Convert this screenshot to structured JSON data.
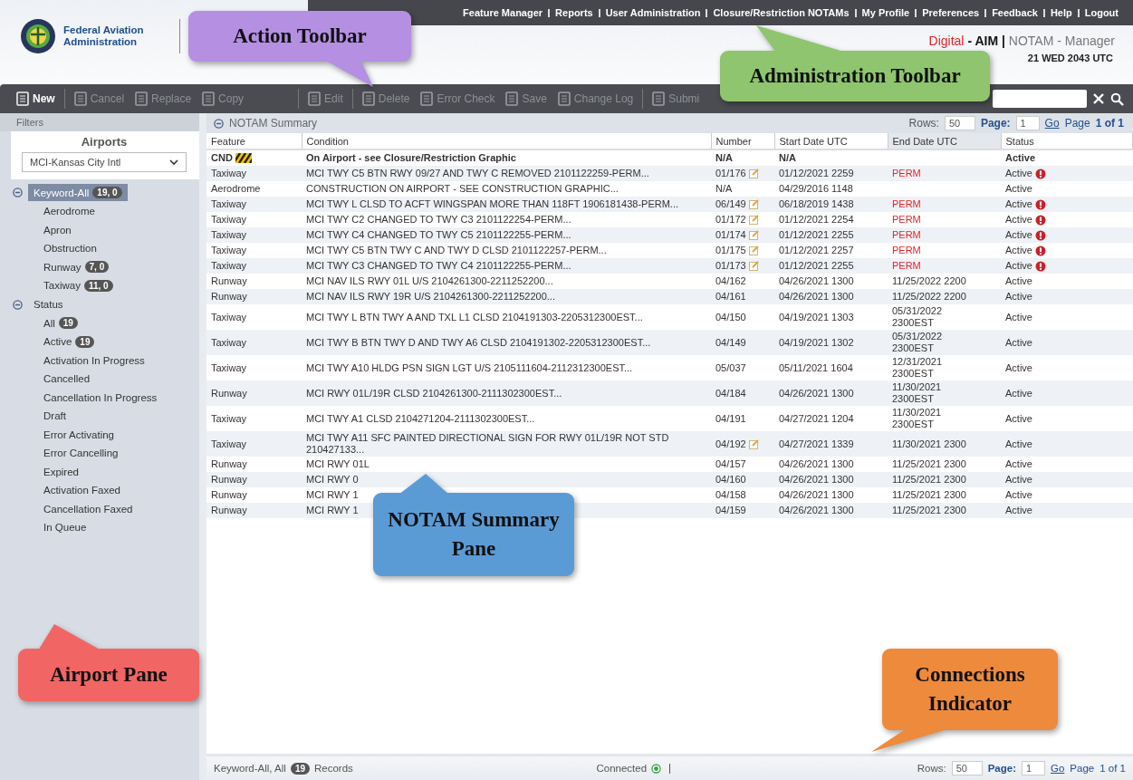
{
  "header": {
    "agency": "Federal Aviation Administration",
    "admin_links": [
      "Feature Manager",
      "Reports",
      "User Administration",
      "Closure/Restriction NOTAMs",
      "My Profile",
      "Preferences",
      "Feedback",
      "Help",
      "Logout"
    ],
    "brand": {
      "digital": "Digital",
      "aim": "- AIM |",
      "product": "NOTAM - Manager"
    },
    "datetime": "21 WED 2043 UTC"
  },
  "toolbar": [
    {
      "kind": "button",
      "label": "New",
      "disabled": false
    },
    {
      "kind": "separator"
    },
    {
      "kind": "button",
      "label": "Cancel",
      "disabled": true
    },
    {
      "kind": "button",
      "label": "Replace",
      "disabled": true
    },
    {
      "kind": "button",
      "label": "Copy",
      "disabled": true
    },
    {
      "kind": "gap"
    },
    {
      "kind": "separator"
    },
    {
      "kind": "button",
      "label": "Edit",
      "disabled": true
    },
    {
      "kind": "separator"
    },
    {
      "kind": "button",
      "label": "Delete",
      "disabled": true
    },
    {
      "kind": "button",
      "label": "Error Check",
      "disabled": true
    },
    {
      "kind": "button",
      "label": "Save",
      "disabled": true
    },
    {
      "kind": "button",
      "label": "Change Log",
      "disabled": true
    },
    {
      "kind": "separator"
    },
    {
      "kind": "button",
      "label": "Submi",
      "disabled": true
    }
  ],
  "filters": {
    "title": "Filters",
    "airports_label": "Airports",
    "airport": "MCI-Kansas City Intl",
    "groups": [
      {
        "label": "Keyword-All",
        "badge": "19, 0",
        "selected": true,
        "expanded": true,
        "children": [
          {
            "label": "Aerodrome"
          },
          {
            "label": "Apron"
          },
          {
            "label": "Obstruction"
          },
          {
            "label": "Runway",
            "badge": "7, 0"
          },
          {
            "label": "Taxiway",
            "badge": "11, 0"
          }
        ]
      },
      {
        "label": "Status",
        "selected": false,
        "expanded": true,
        "children": [
          {
            "label": "All",
            "badge": "19"
          },
          {
            "label": "Active",
            "badge": "19"
          },
          {
            "label": "Activation In Progress"
          },
          {
            "label": "Cancelled"
          },
          {
            "label": "Cancellation In Progress"
          },
          {
            "label": "Draft"
          },
          {
            "label": "Error Activating"
          },
          {
            "label": "Error Cancelling"
          },
          {
            "label": "Expired"
          },
          {
            "label": "Activation Faxed"
          },
          {
            "label": "Cancellation Faxed"
          },
          {
            "label": "In Queue"
          }
        ]
      }
    ]
  },
  "summary": {
    "title": "NOTAM Summary",
    "rows_label": "Rows:",
    "rows_value": "50",
    "page_label": "Page:",
    "page_value": "1",
    "go": "Go",
    "page_word": "Page",
    "page_of": "1 of 1",
    "columns": [
      "Feature",
      "Condition",
      "Number",
      "Start Date UTC",
      "End Date UTC",
      "Status"
    ],
    "rows": [
      {
        "kind": "closure",
        "feature": "CND",
        "condition": "On Airport - see Closure/Restriction Graphic",
        "number": "N/A",
        "edit": false,
        "start": "N/A",
        "end": "",
        "status": "Active",
        "alert": false
      },
      {
        "kind": "notam",
        "feature": "Taxiway",
        "condition": "MCI TWY C5 BTN RWY 09/27 AND TWY C REMOVED 2101122259-PERM...",
        "number": "01/176",
        "edit": true,
        "start": "01/12/2021 2259",
        "end": "PERM",
        "permanent": true,
        "status": "Active",
        "alert": true
      },
      {
        "kind": "notam",
        "feature": "Aerodrome",
        "condition": "CONSTRUCTION ON AIRPORT - SEE CONSTRUCTION GRAPHIC...",
        "number": "N/A",
        "edit": false,
        "start": "04/29/2016 1148",
        "end": "",
        "status": "Active",
        "alert": false
      },
      {
        "kind": "notam",
        "feature": "Taxiway",
        "condition": "MCI TWY L CLSD TO ACFT WINGSPAN MORE THAN 118FT 1906181438-PERM...",
        "number": "06/149",
        "edit": true,
        "start": "06/18/2019 1438",
        "end": "PERM",
        "permanent": true,
        "status": "Active",
        "alert": true
      },
      {
        "kind": "notam",
        "feature": "Taxiway",
        "condition": "MCI TWY C2 CHANGED TO TWY C3 2101122254-PERM...",
        "number": "01/172",
        "edit": true,
        "start": "01/12/2021 2254",
        "end": "PERM",
        "permanent": true,
        "status": "Active",
        "alert": true
      },
      {
        "kind": "notam",
        "feature": "Taxiway",
        "condition": "MCI TWY C4 CHANGED TO TWY C5 2101122255-PERM...",
        "number": "01/174",
        "edit": true,
        "start": "01/12/2021 2255",
        "end": "PERM",
        "permanent": true,
        "status": "Active",
        "alert": true
      },
      {
        "kind": "notam",
        "feature": "Taxiway",
        "condition": "MCI TWY C5 BTN TWY C AND TWY D CLSD 2101122257-PERM...",
        "number": "01/175",
        "edit": true,
        "start": "01/12/2021 2257",
        "end": "PERM",
        "permanent": true,
        "status": "Active",
        "alert": true
      },
      {
        "kind": "notam",
        "feature": "Taxiway",
        "condition": "MCI TWY C3 CHANGED TO TWY C4 2101122255-PERM...",
        "number": "01/173",
        "edit": true,
        "start": "01/12/2021 2255",
        "end": "PERM",
        "permanent": true,
        "status": "Active",
        "alert": true
      },
      {
        "kind": "notam",
        "feature": "Runway",
        "condition": "MCI NAV ILS RWY 01L U/S 2104261300-2211252200...",
        "number": "04/162",
        "edit": false,
        "start": "04/26/2021 1300",
        "end": "11/25/2022 2200",
        "permanent": false,
        "status": "Active",
        "alert": false
      },
      {
        "kind": "notam",
        "feature": "Runway",
        "condition": "MCI NAV ILS RWY 19R U/S 2104261300-2211252200...",
        "number": "04/161",
        "edit": false,
        "start": "04/26/2021 1300",
        "end": "11/25/2022 2200",
        "permanent": false,
        "status": "Active",
        "alert": false
      },
      {
        "kind": "notam",
        "feature": "Taxiway",
        "condition": "MCI TWY L BTN TWY A AND TXL L1 CLSD 2104191303-2205312300EST...",
        "number": "04/150",
        "edit": false,
        "start": "04/19/2021 1303",
        "end": "05/31/2022 2300EST",
        "permanent": false,
        "status": "Active",
        "alert": false
      },
      {
        "kind": "notam",
        "feature": "Taxiway",
        "condition": "MCI TWY B BTN TWY D AND TWY A6 CLSD 2104191302-2205312300EST...",
        "number": "04/149",
        "edit": false,
        "start": "04/19/2021 1302",
        "end": "05/31/2022 2300EST",
        "permanent": false,
        "status": "Active",
        "alert": false
      },
      {
        "kind": "notam",
        "feature": "Taxiway",
        "condition": "MCI TWY A10 HLDG PSN SIGN LGT U/S 2105111604-2112312300EST...",
        "number": "05/037",
        "edit": false,
        "start": "05/11/2021 1604",
        "end": "12/31/2021 2300EST",
        "permanent": false,
        "status": "Active",
        "alert": false
      },
      {
        "kind": "notam",
        "feature": "Runway",
        "condition": "MCI RWY 01L/19R CLSD 2104261300-2111302300EST...",
        "number": "04/184",
        "edit": false,
        "start": "04/26/2021 1300",
        "end": "11/30/2021 2300EST",
        "permanent": false,
        "status": "Active",
        "alert": false
      },
      {
        "kind": "notam",
        "feature": "Taxiway",
        "condition": "MCI TWY A1 CLSD 2104271204-2111302300EST...",
        "number": "04/191",
        "edit": false,
        "start": "04/27/2021 1204",
        "end": "11/30/2021 2300EST",
        "permanent": false,
        "status": "Active",
        "alert": false
      },
      {
        "kind": "notam",
        "feature": "Taxiway",
        "condition": "MCI TWY A11 SFC PAINTED DIRECTIONAL SIGN FOR RWY 01L/19R NOT STD 210427133...",
        "number": "04/192",
        "edit": true,
        "start": "04/27/2021 1339",
        "end": "11/30/2021 2300",
        "permanent": false,
        "status": "Active",
        "alert": false
      },
      {
        "kind": "notam",
        "feature": "Runway",
        "condition": "MCI RWY 01L",
        "number": "04/157",
        "edit": false,
        "start": "04/26/2021 1300",
        "end": "11/25/2021 2300",
        "permanent": false,
        "status": "Active",
        "alert": false
      },
      {
        "kind": "notam",
        "feature": "Runway",
        "condition": "MCI RWY 0",
        "number": "04/160",
        "edit": false,
        "start": "04/26/2021 1300",
        "end": "11/25/2021 2300",
        "permanent": false,
        "status": "Active",
        "alert": false
      },
      {
        "kind": "notam",
        "feature": "Runway",
        "condition": "MCI RWY 1",
        "number": "04/158",
        "edit": false,
        "start": "04/26/2021 1300",
        "end": "11/25/2021 2300",
        "permanent": false,
        "status": "Active",
        "alert": false
      },
      {
        "kind": "notam",
        "feature": "Runway",
        "condition": "MCI RWY 1",
        "number": "04/159",
        "edit": false,
        "start": "04/26/2021 1300",
        "end": "11/25/2021 2300",
        "permanent": false,
        "status": "Active",
        "alert": false
      }
    ]
  },
  "status_bar": {
    "filter_text": "Keyword-All, All",
    "count": "19",
    "records": "Records",
    "connection": "Connected",
    "connected": true,
    "rows_label": "Rows:",
    "rows_value": "50",
    "page_label": "Page:",
    "page_value": "1",
    "go": "Go",
    "page_word": "Page",
    "page_of": "1 of 1"
  },
  "callouts": [
    {
      "text": "Action Toolbar",
      "color": "#b58fe2"
    },
    {
      "text": "Administration Toolbar",
      "color": "#8ec56e"
    },
    {
      "text": "NOTAM Summary Pane",
      "color": "#5b9bd5"
    },
    {
      "text": "Airport Pane",
      "color": "#f26565"
    },
    {
      "text": "Connections Indicator",
      "color": "#ee8a3c"
    }
  ]
}
